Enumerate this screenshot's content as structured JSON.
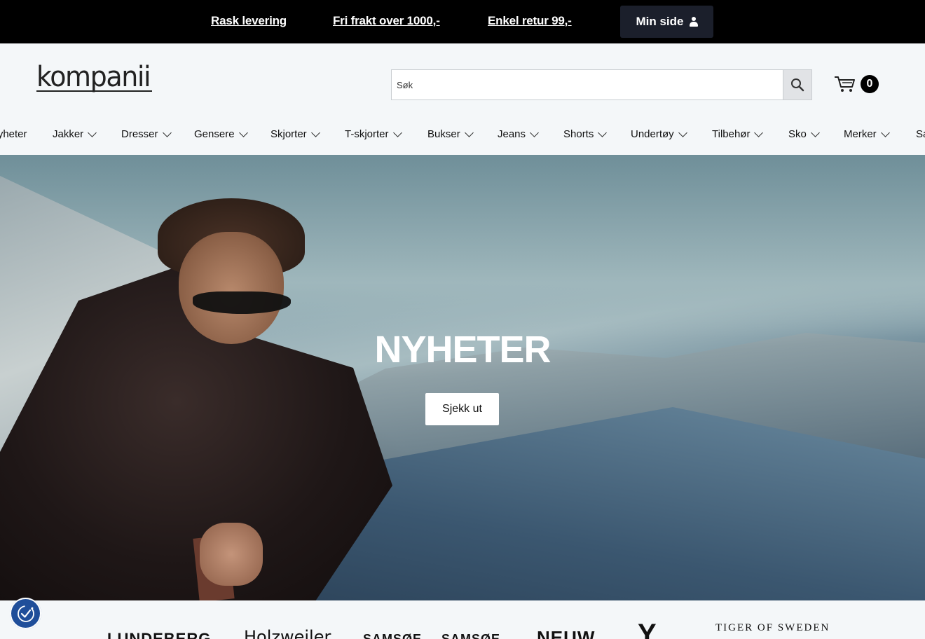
{
  "topbar": {
    "promos": [
      "Rask levering",
      "Fri frakt over 1000,-",
      "Enkel retur 99,-"
    ],
    "my_page_label": "Min side"
  },
  "header": {
    "logo_text": "kompanii",
    "search": {
      "placeholder": "Søk",
      "value": ""
    },
    "cart_count": "0"
  },
  "nav": {
    "items": [
      "Nyheter",
      "Jakker",
      "Dresser",
      "Gensere",
      "Skjorter",
      "T-skjorter",
      "Bukser",
      "Jeans",
      "Shorts",
      "Undertøy",
      "Tilbehør",
      "Sko",
      "Merker",
      "Salg"
    ]
  },
  "hero": {
    "title": "NYHETER",
    "cta_label": "Sjekk ut"
  },
  "brands": [
    "LUNDEBERG",
    "Holzweiler",
    "SAMSØE",
    "SAMSØE",
    "NEUW",
    "Y",
    "TIGER OF SWEDEN"
  ],
  "icons": {
    "account": "user-icon",
    "search": "search-icon",
    "cart": "cart-icon",
    "cookie": "cookie-consent-icon"
  },
  "colors": {
    "topbar_bg": "#000000",
    "my_page_bg": "#1b1f2b",
    "page_bg": "#f4f7f9",
    "cookie_bg": "#1f4e9a"
  }
}
